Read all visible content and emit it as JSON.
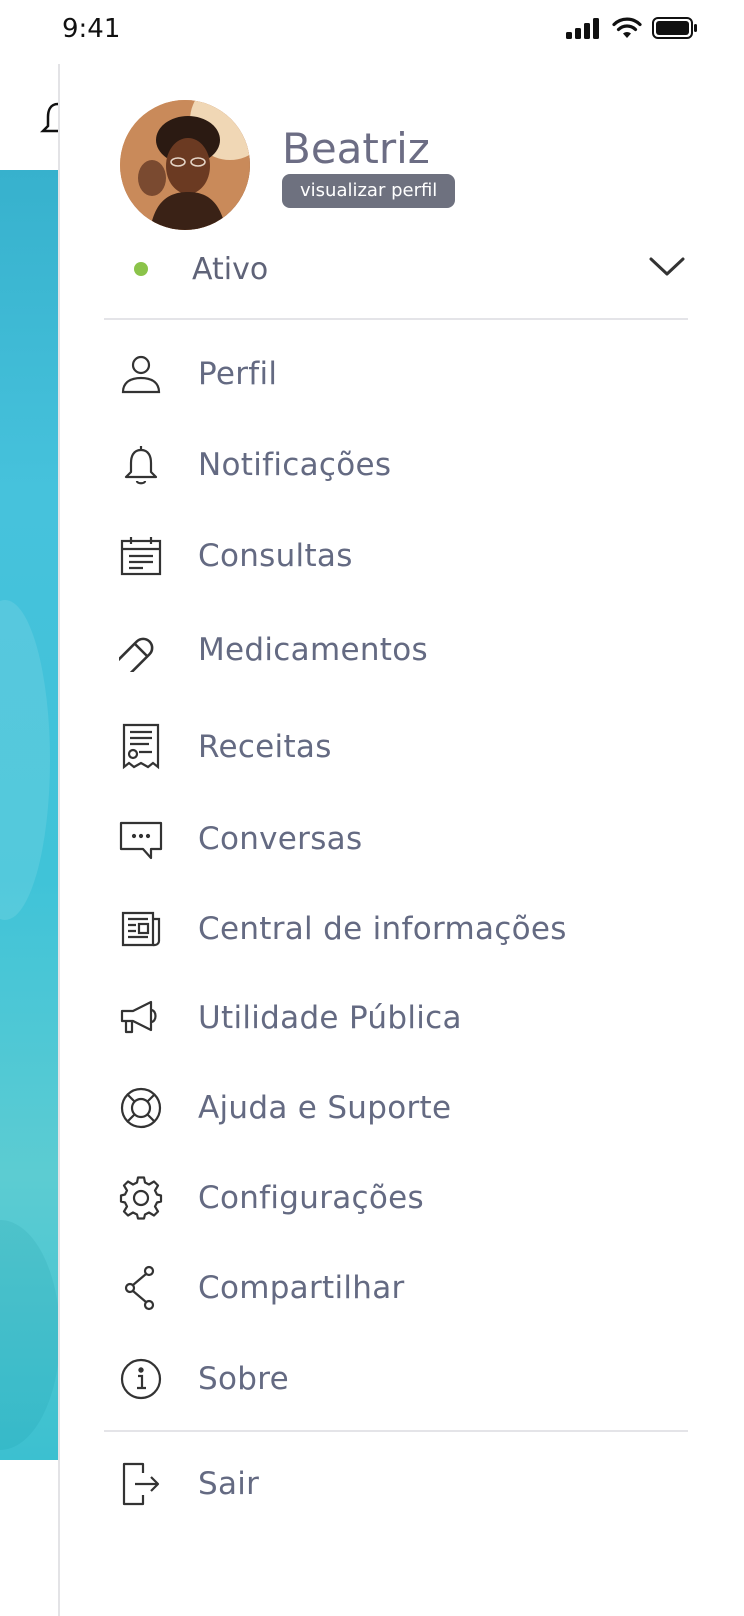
{
  "status_bar": {
    "time": "9:41"
  },
  "user": {
    "name": "Beatriz",
    "profile_badge": "visualizar perfil",
    "status": "Ativo",
    "status_color": "#8bc34a"
  },
  "menu": {
    "items": [
      {
        "label": "Perfil",
        "icon": "user-icon"
      },
      {
        "label": "Notificações",
        "icon": "bell-icon"
      },
      {
        "label": "Consultas",
        "icon": "calendar-icon"
      },
      {
        "label": "Medicamentos",
        "icon": "pill-icon"
      },
      {
        "label": "Receitas",
        "icon": "receipt-icon"
      },
      {
        "label": "Conversas",
        "icon": "chat-icon"
      },
      {
        "label": "Central de informações",
        "icon": "newspaper-icon"
      },
      {
        "label": "Utilidade Pública",
        "icon": "megaphone-icon"
      },
      {
        "label": "Ajuda e Suporte",
        "icon": "lifebuoy-icon"
      },
      {
        "label": "Configurações",
        "icon": "gear-icon"
      },
      {
        "label": "Compartilhar",
        "icon": "share-icon"
      },
      {
        "label": "Sobre",
        "icon": "info-icon"
      }
    ],
    "logout": {
      "label": "Sair",
      "icon": "logout-icon"
    }
  },
  "colors": {
    "text": "#646a82",
    "badge_bg": "#6e717f",
    "accent_gradient_start": "#37b1cd",
    "accent_gradient_end": "#3cc0d0"
  }
}
